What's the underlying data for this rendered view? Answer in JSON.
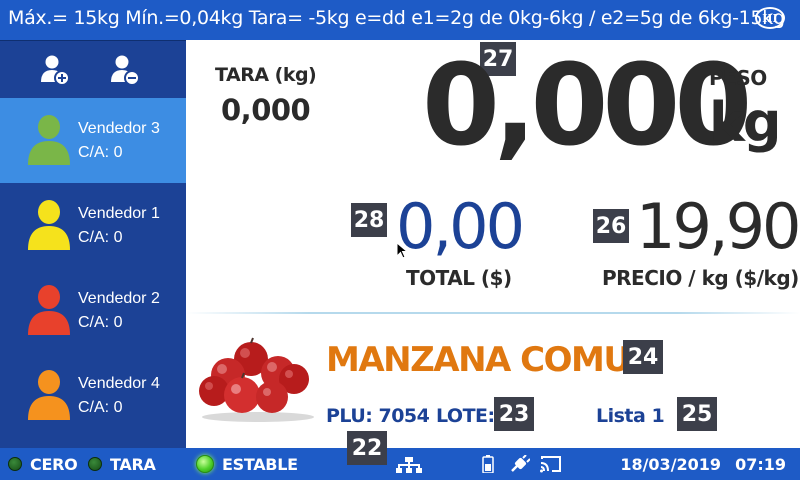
{
  "topbar": {
    "spec_text": "Máx.= 15kg  Mín.=0,04kg  Tara= -5kg  e=dd  e1=2g de 0kg-6kg / e2=5g de 6kg-15kg",
    "accuracy_class": "III"
  },
  "sidebar": {
    "actions": [
      "user-add-icon",
      "user-remove-icon"
    ],
    "vendors": [
      {
        "name": "Vendedor 3",
        "count": "C/A: 0",
        "color": "#7ab648",
        "active": true
      },
      {
        "name": "Vendedor 1",
        "count": "C/A: 0",
        "color": "#f5e21c",
        "active": false
      },
      {
        "name": "Vendedor 2",
        "count": "C/A: 0",
        "color": "#e8412c",
        "active": false
      },
      {
        "name": "Vendedor 4",
        "count": "C/A: 0",
        "color": "#f5921e",
        "active": false
      }
    ]
  },
  "tare": {
    "title": "TARA (kg)",
    "value": "0,000"
  },
  "weight": {
    "value": "0,000",
    "peso_label": "PESO",
    "unit": "kg",
    "badge": "27"
  },
  "total": {
    "value": "0,00",
    "label": "TOTAL ($)",
    "badge": "28"
  },
  "price": {
    "value": "19,90",
    "label": "PRECIO / kg ($/kg)",
    "badge": "26"
  },
  "product": {
    "name": "MANZANA COMUN",
    "name_badge": "24",
    "plu": "PLU: 7054",
    "lote": "LOTE:",
    "lote_badge": "23",
    "list": "Lista 1",
    "list_badge": "25",
    "extra_badge": "22",
    "image": "apples-image"
  },
  "status_bar": {
    "cero": "CERO",
    "tara": "TARA",
    "estable": "ESTABLE",
    "icons": [
      "network-icon",
      "battery-icon",
      "plug-icon",
      "cast-icon"
    ],
    "date": "18/03/2019",
    "time": "07:19"
  },
  "colors": {
    "bar_blue": "#1e5bc6",
    "sidebar_navy": "#1c4296",
    "active_vendor": "#3d8de3",
    "product_orange": "#e07810",
    "badge_gray": "#3c3f4a"
  }
}
